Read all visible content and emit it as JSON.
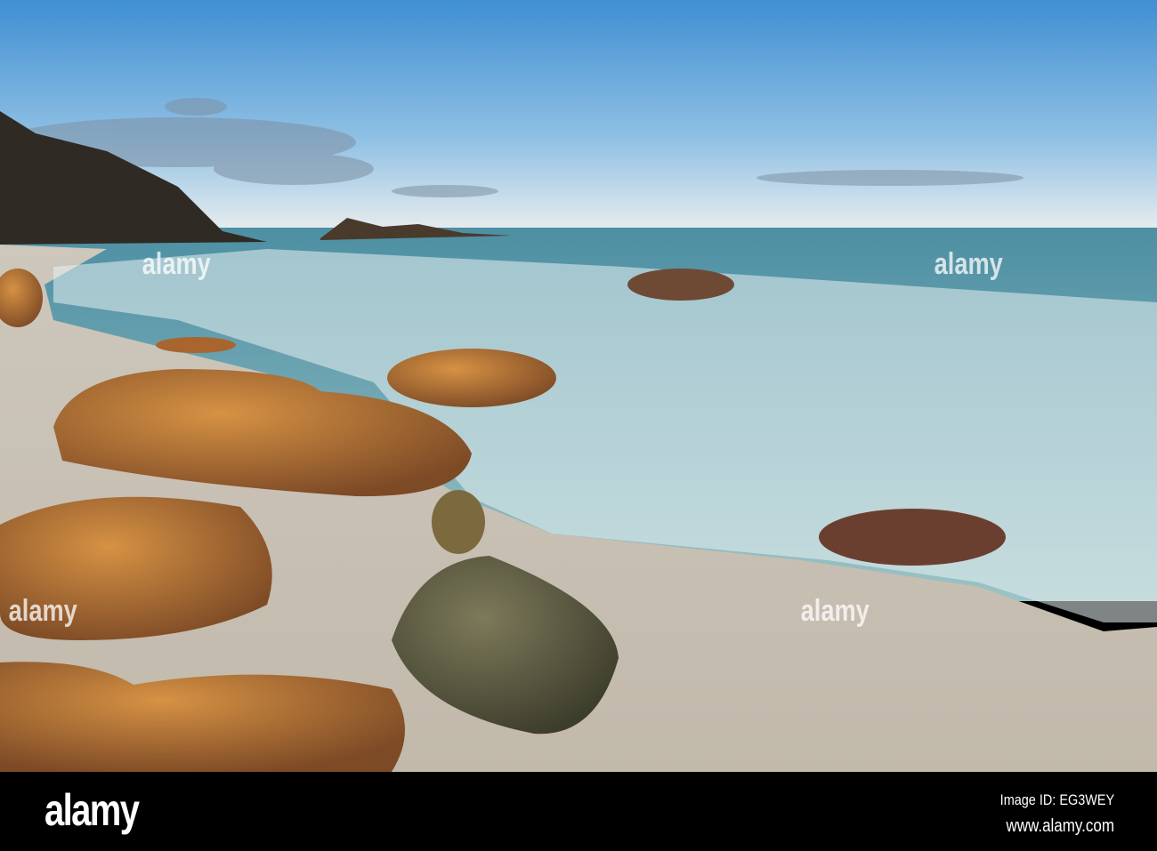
{
  "photo": {
    "subject": "Rocky beach with waves at sunset",
    "watermark_text": "alamy"
  },
  "footer": {
    "logo": "alamy",
    "image_id": "Image ID: EG3WEY",
    "website": "www.alamy.com"
  },
  "colors": {
    "sky_top": "#3f8fd2",
    "sky_horizon": "#e9eef0",
    "sea": "#5f9aa4",
    "sand": "#c9c3b7",
    "rock": "#b8742f"
  }
}
